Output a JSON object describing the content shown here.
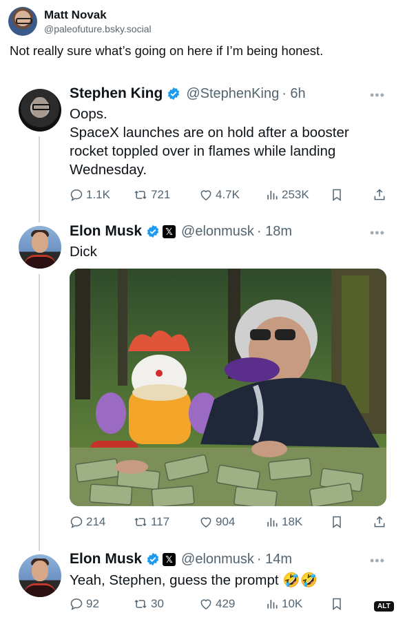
{
  "post": {
    "author_name": "Matt Novak",
    "author_handle": "@paleofuture.bsky.social",
    "text": "Not really sure what’s going on here if I’m being honest."
  },
  "tweets": [
    {
      "name": "Stephen King",
      "handle": "@StephenKing",
      "time": "· 6h",
      "text_lines": [
        "Oops.",
        "SpaceX launches are on hold after a booster",
        "rocket toppled over in flames while landing",
        "Wednesday."
      ],
      "replies": "1.1K",
      "reposts": "721",
      "likes": "4.7K",
      "views": "253K"
    },
    {
      "name": "Elon Musk",
      "handle": "@elonmusk",
      "time": "· 18m",
      "text_lines": [
        "Dick"
      ],
      "replies": "214",
      "reposts": "117",
      "likes": "904",
      "views": "18K"
    },
    {
      "name": "Elon Musk",
      "handle": "@elonmusk",
      "time": "· 14m",
      "text_lines": [
        "Yeah, Stephen, guess the prompt 🤣🤣"
      ],
      "replies": "92",
      "reposts": "30",
      "likes": "429",
      "views": "10K"
    }
  ],
  "alt_badge": "ALT",
  "colors": {
    "verified_blue": "#1d9bf0",
    "muted_text": "#536471",
    "thread_line": "#cfd9de"
  }
}
